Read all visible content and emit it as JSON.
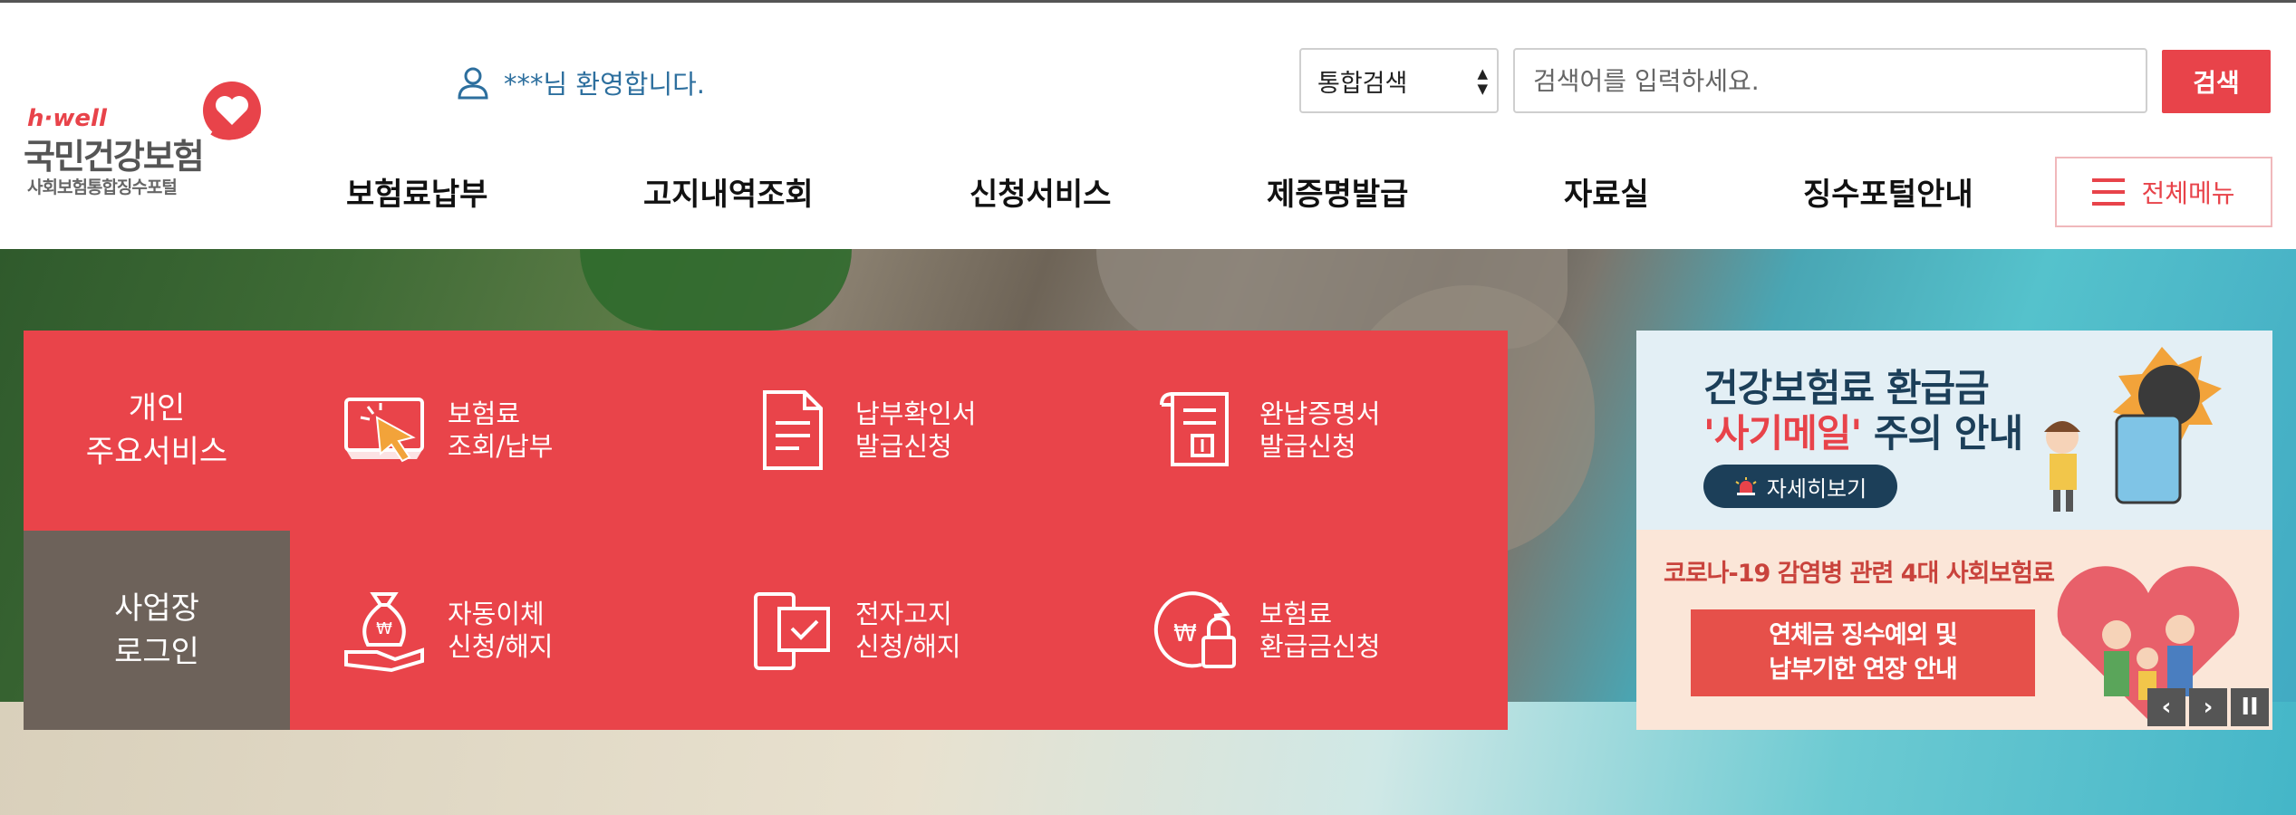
{
  "logo": {
    "brand": "h·well",
    "name": "국민건강보험",
    "sub": "사회보험통합징수포털"
  },
  "welcome": {
    "text": "***님 환영합니다."
  },
  "search": {
    "select_value": "통합검색",
    "placeholder": "검색어를 입력하세요.",
    "button": "검색"
  },
  "gnb": [
    {
      "label": "보험료납부"
    },
    {
      "label": "고지내역조회"
    },
    {
      "label": "신청서비스"
    },
    {
      "label": "제증명발급"
    },
    {
      "label": "자료실"
    },
    {
      "label": "징수포털안내"
    }
  ],
  "all_menu": {
    "label": "전체메뉴"
  },
  "services": {
    "personal_label": [
      "개인",
      "주요서비스"
    ],
    "business_label": [
      "사업장",
      "로그인"
    ],
    "items": [
      {
        "lines": [
          "보험료",
          "조회/납부"
        ],
        "icon": "cursor-screen-icon"
      },
      {
        "lines": [
          "납부확인서",
          "발급신청"
        ],
        "icon": "document-icon"
      },
      {
        "lines": [
          "완납증명서",
          "발급신청"
        ],
        "icon": "certificate-scroll-icon"
      },
      {
        "lines": [
          "자동이체",
          "신청/해지"
        ],
        "icon": "money-bag-hand-icon"
      },
      {
        "lines": [
          "전자고지",
          "신청/해지"
        ],
        "icon": "electronic-notice-icon"
      },
      {
        "lines": [
          "보험료",
          "환급금신청"
        ],
        "icon": "refund-lock-icon"
      }
    ]
  },
  "banner": {
    "top_line1": "건강보험료 환급금",
    "top_line2_highlight": "'사기메일'",
    "top_line2_rest": " 주의 안내",
    "more_button": "자세히보기",
    "bottom_caption": "코로나-19 감염병 관련 4대 사회보험료",
    "ribbon_line1": "연체금 징수예외 및",
    "ribbon_line2": "납부기한 연장 안내"
  },
  "controls": {
    "prev": "‹",
    "next": "›",
    "pause": "II"
  },
  "colors": {
    "accent": "#e8434a",
    "business": "#6d625a",
    "link": "#2d6f9e"
  }
}
